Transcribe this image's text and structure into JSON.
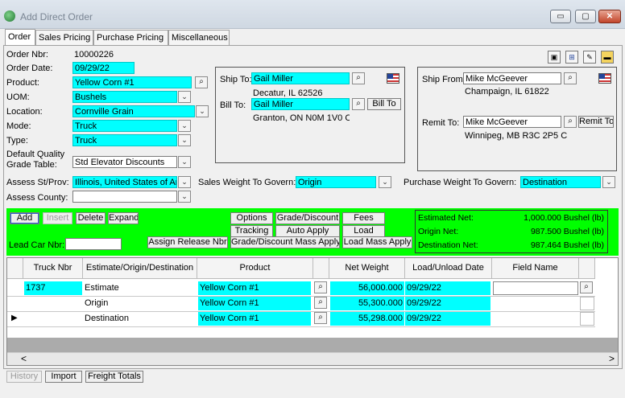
{
  "window": {
    "title": "Add Direct Order",
    "minimize": "▭",
    "maximize": "▢",
    "close": "✕"
  },
  "tabs": [
    "Order",
    "Sales Pricing",
    "Purchase Pricing",
    "Miscellaneous"
  ],
  "toolbar_icons": [
    "save-icon",
    "grid-icon",
    "edit-icon",
    "folder-icon"
  ],
  "order": {
    "order_nbr_label": "Order Nbr:",
    "order_nbr": "10000226",
    "order_date_label": "Order Date:",
    "order_date": "09/29/22",
    "product_label": "Product:",
    "product": "Yellow Corn #1",
    "uom_label": "UOM:",
    "uom": "Bushels",
    "location_label": "Location:",
    "location": "Cornville Grain",
    "mode_label": "Mode:",
    "mode": "Truck",
    "type_label": "Type:",
    "type": "Truck",
    "dqgt_label_1": "Default Quality",
    "dqgt_label_2": "Grade Table:",
    "dqgt": "Std Elevator Discounts",
    "assess_st_label": "Assess St/Prov:",
    "assess_st": "Illinois, United States of An",
    "assess_county_label": "Assess County:",
    "assess_county": ""
  },
  "ship_bill": {
    "ship_to_label": "Ship To:",
    "ship_to": "Gail Miller",
    "ship_to_addr": "Decatur, IL 62526",
    "bill_to_label": "Bill To:",
    "bill_to": "Gail Miller",
    "bill_to_addr": "Granton, ON N0M 1V0 C/",
    "bill_to_button": "Bill To"
  },
  "ship_from_remit": {
    "ship_from_label": "Ship From:",
    "ship_from": "Mike McGeever",
    "ship_from_addr": "Champaign, IL 61822",
    "remit_to_label": "Remit To:",
    "remit_to": "Mike McGeever",
    "remit_to_addr": "Winnipeg, MB R3C 2P5 C",
    "remit_to_button": "Remit To"
  },
  "weights": {
    "sales_label": "Sales Weight To Govern:",
    "sales": "Origin",
    "purchase_label": "Purchase Weight To Govern:",
    "purchase": "Destination"
  },
  "actions": {
    "add": "Add",
    "insert": "Insert",
    "delete": "Delete",
    "expand": "Expand",
    "lead_car_label": "Lead Car Nbr:",
    "lead_car": "",
    "options": "Options",
    "grade_discount": "Grade/Discount",
    "fees": "Fees",
    "tracking": "Tracking",
    "auto_apply": "Auto Apply",
    "load": "Load",
    "assign_release": "Assign Release Nbr",
    "grade_discount_mass": "Grade/Discount Mass Apply",
    "load_mass": "Load Mass Apply"
  },
  "net": {
    "estimated_label": "Estimated Net:",
    "estimated": "1,000.000 Bushel (lb)",
    "origin_label": "Origin Net:",
    "origin": "987.500 Bushel (lb)",
    "destination_label": "Destination Net:",
    "destination": "987.464 Bushel (lb)"
  },
  "grid": {
    "headers": [
      "Truck Nbr",
      "Estimate/Origin/Destination",
      "Product",
      "Net Weight",
      "Load/Unload Date",
      "Field Name"
    ],
    "rows": [
      {
        "truck": "1737",
        "stage": "Estimate",
        "product": "Yellow Corn #1",
        "weight": "56,000.000",
        "date": "09/29/22",
        "field": ""
      },
      {
        "truck": "",
        "stage": "Origin",
        "product": "Yellow Corn #1",
        "weight": "55,300.000",
        "date": "09/29/22",
        "field": ""
      },
      {
        "truck": "",
        "stage": "Destination",
        "product": "Yellow Corn #1",
        "weight": "55,298.000",
        "date": "09/29/22",
        "field": ""
      }
    ],
    "scroll_left": "<",
    "scroll_right": ">"
  },
  "bottom": {
    "history": "History",
    "import": "Import",
    "freight_totals": "Freight Totals"
  },
  "colors": {
    "required_field": "#00ffff",
    "action_panel": "#00ff00"
  }
}
